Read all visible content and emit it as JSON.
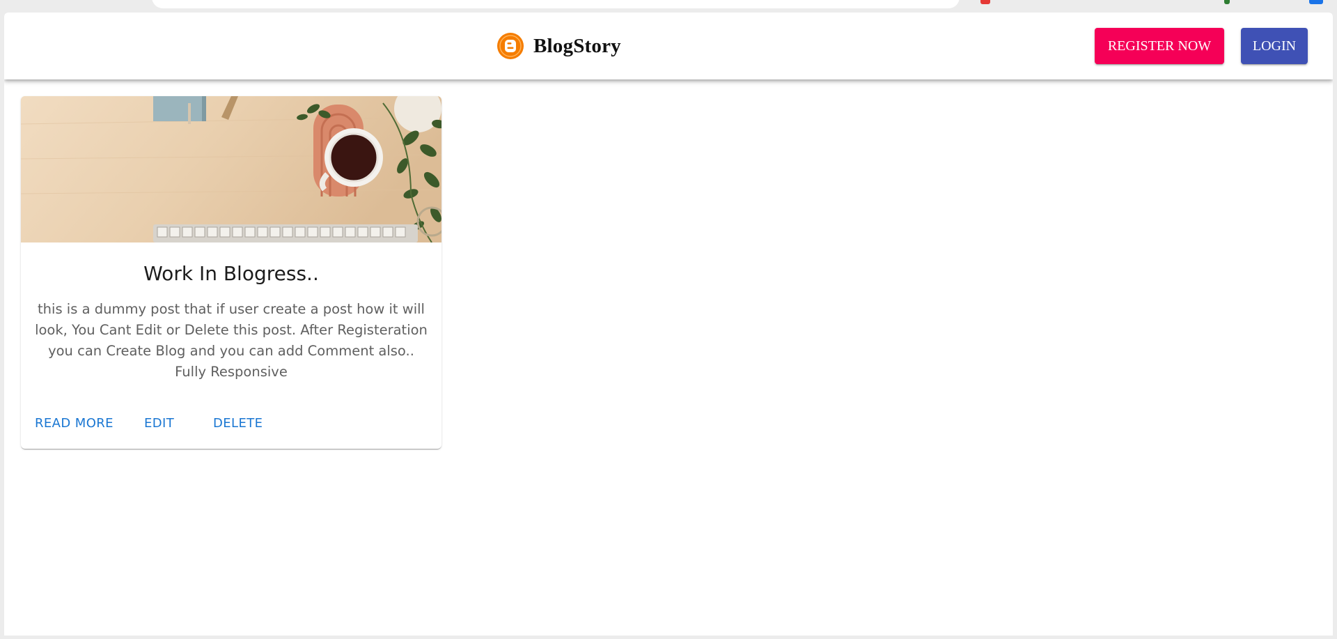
{
  "header": {
    "brand_name": "BlogStory",
    "logo_icon": "blogger-logo-icon",
    "register_label": "REGISTER NOW",
    "login_label": "LOGIN"
  },
  "colors": {
    "register": "#f50057",
    "login": "#3f51b5",
    "logo": "#f57d00",
    "action": "#1976d2"
  },
  "posts": [
    {
      "image": "desk-with-coffee-keyboard-plant",
      "title": "Work In Blogress..",
      "body": "this is a dummy post that if user create a post how it will look, You Cant Edit or Delete this post. After Registeration you can Create Blog and you can add Comment also.. Fully Responsive",
      "actions": {
        "read_more": "READ MORE",
        "edit": "EDIT",
        "delete": "DELETE"
      }
    }
  ]
}
